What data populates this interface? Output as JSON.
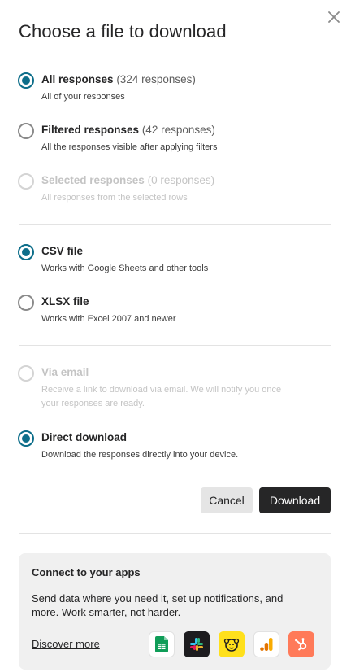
{
  "dialog": {
    "title": "Choose a file to download"
  },
  "scope": [
    {
      "title": "All responses",
      "count": "(324 responses)",
      "desc": "All of your responses"
    },
    {
      "title": "Filtered responses",
      "count": "(42 responses)",
      "desc": "All the responses visible after applying filters"
    },
    {
      "title": "Selected responses",
      "count": "(0 responses)",
      "desc": "All responses from the selected rows"
    }
  ],
  "format": [
    {
      "title": "CSV file",
      "desc": "Works with Google Sheets and other tools"
    },
    {
      "title": "XLSX file",
      "desc": "Works with Excel 2007 and newer"
    }
  ],
  "delivery": [
    {
      "title": "Via email",
      "desc": "Receive a link to download via email. We will notify you once your responses are ready."
    },
    {
      "title": "Direct download",
      "desc": "Download the responses directly into your device."
    }
  ],
  "buttons": {
    "cancel": "Cancel",
    "download": "Download"
  },
  "connect": {
    "title": "Connect to your apps",
    "text": "Send data where you need it, set up notifications, and more. Work smarter, not harder.",
    "link": "Discover more",
    "apps": [
      "google-sheets-icon",
      "slack-icon",
      "mailchimp-icon",
      "google-analytics-icon",
      "hubspot-icon"
    ]
  },
  "colors": {
    "accent": "#0d6e8a",
    "primary_button": "#262627",
    "card_bg": "#f0f0f0"
  }
}
